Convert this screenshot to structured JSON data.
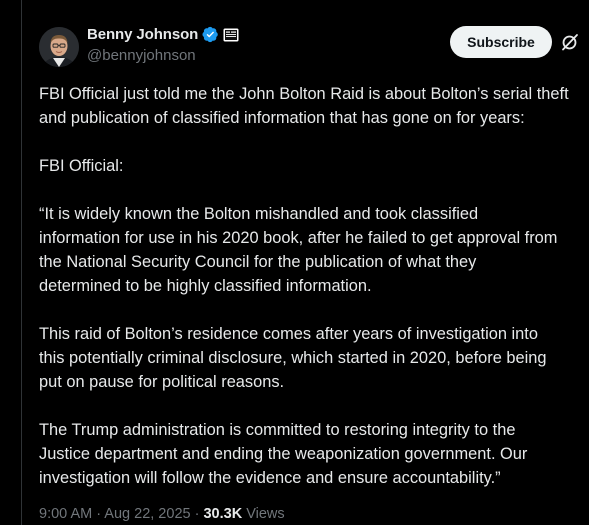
{
  "author": {
    "name": "Benny Johnson",
    "handle": "@bennyjohnson",
    "avatar_icon": "avatar-portrait",
    "verified_icon": "verified-badge-icon",
    "affiliate_icon": "affiliate-badge-icon"
  },
  "actions": {
    "subscribe_label": "Subscribe",
    "grok_icon": "grok-icon"
  },
  "post": {
    "paragraphs": [
      {
        "lines": [
          "FBI Official just told me the John Bolton Raid is about Bolton’s serial theft",
          "and publication of classified information that has gone on for years:"
        ]
      },
      {
        "lines": [
          "FBI Official:"
        ]
      },
      {
        "lines": [
          "“It is widely known the Bolton mishandled and took classified",
          "information for use in his 2020 book, after he failed to get approval from",
          "the National Security Council for the publication of what they",
          "determined to be highly classified information."
        ]
      },
      {
        "lines": [
          "This raid of Bolton’s residence comes after years of investigation into",
          "this potentially criminal disclosure, which started in 2020, before being",
          "put on pause for political reasons."
        ]
      },
      {
        "lines": [
          "The Trump administration is committed to restoring integrity to the",
          "Justice department and ending the weaponization government. Our",
          "investigation will follow the evidence and ensure accountability.”"
        ]
      }
    ]
  },
  "meta": {
    "time": "9:00 AM",
    "separator": " · ",
    "date": "Aug 22, 2025",
    "views_count": "30.3K",
    "views_label": "Views"
  },
  "colors": {
    "background": "#000000",
    "text": "#e7e9ea",
    "muted": "#71767b",
    "verified": "#1d9bf0",
    "button_bg": "#eff3f4"
  }
}
